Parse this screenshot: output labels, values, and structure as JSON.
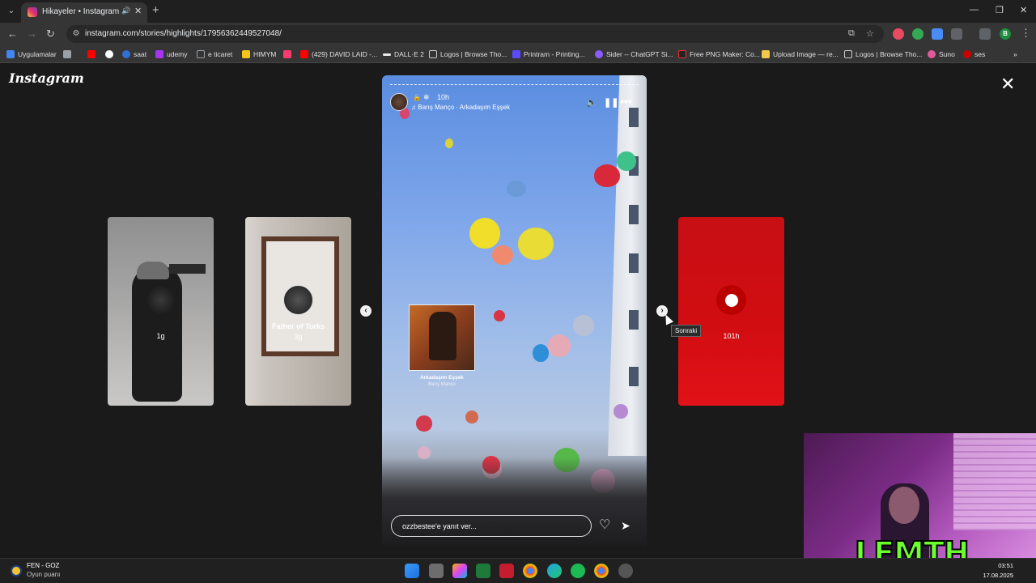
{
  "browser": {
    "tab_title": "Hikayeler • Instagram",
    "url": "instagram.com/stories/highlights/17956362449527048/",
    "profile_initial": "B"
  },
  "bookmarks": [
    {
      "label": "Uygulamalar",
      "color": "#4285f4"
    },
    {
      "label": "",
      "color": "#ff0000"
    },
    {
      "label": "",
      "color": "#ffffff"
    },
    {
      "label": "saat",
      "color": "#2f6fd6"
    },
    {
      "label": "udemy",
      "color": "#a435f0"
    },
    {
      "label": "e ticaret",
      "color": "#9aa0a6"
    },
    {
      "label": "HIMYM",
      "color": "#f5c518"
    },
    {
      "label": "(429) DAVID LAID -...",
      "color": "#ff0000"
    },
    {
      "label": "DALL·E 2",
      "color": "#e8eaed"
    },
    {
      "label": "Logos | Browse Tho...",
      "color": "#cccccc"
    },
    {
      "label": "Printram - Printing...",
      "color": "#5b4bff"
    },
    {
      "label": "Sider -- ChatGPT Si...",
      "color": "#8a5cff"
    },
    {
      "label": "Free PNG Maker: Co...",
      "color": "#222222"
    },
    {
      "label": "Upload Image — re...",
      "color": "#f2c94c"
    },
    {
      "label": "Logos | Browse Tho...",
      "color": "#cccccc"
    },
    {
      "label": "Suno",
      "color": "#e05a9a"
    },
    {
      "label": "ses",
      "color": "#cc0000"
    }
  ],
  "page": {
    "logo": "Instagram",
    "tooltip_next": "Sonraki"
  },
  "side_cards": [
    {
      "name": "",
      "time": "1g"
    },
    {
      "name": "Father of Turks",
      "time": "3g"
    },
    {
      "name": "",
      "time": "101h"
    }
  ],
  "story": {
    "time": "10h",
    "music": "Barış Manço · Arkadaşım Eşşek",
    "album_title": "Arkadaşım Eşşek",
    "album_artist": "Barış Manço",
    "reply_placeholder": "ozzbestee'e yanıt ver...",
    "progress": 0.0
  },
  "overlay": {
    "streamer_name": "LEMTH"
  },
  "taskbar": {
    "weather_line1": "FEN - GOZ",
    "weather_line2": "Oyun puanı",
    "time": "03:51",
    "date": "17.08.2025"
  },
  "colors": {
    "spotify": "#1db954",
    "accent_red": "#d20d12",
    "webcam_bg": "#7b2c86",
    "streamer_text": "#6bff2d"
  }
}
